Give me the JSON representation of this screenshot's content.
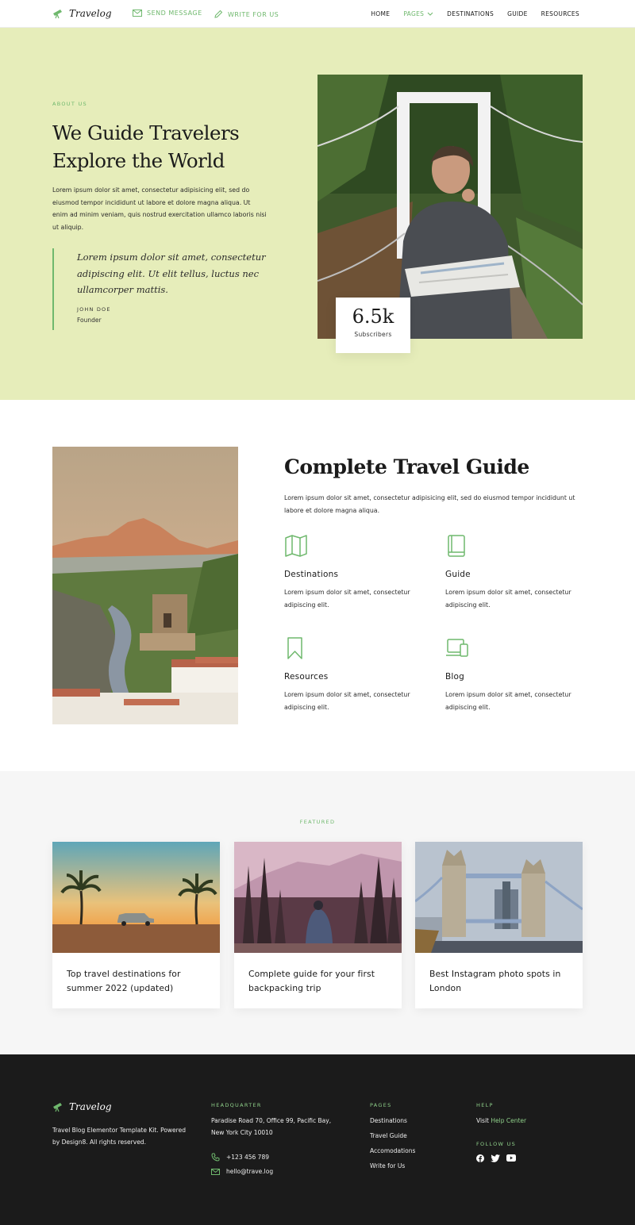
{
  "brand": {
    "name": "Travelog",
    "accent": "#6fb86d",
    "hero_bg": "#e6edba",
    "footer_bg": "#1b1b1b"
  },
  "nav": {
    "send_message": "SEND MESSAGE",
    "write_for_us": "WRITE FOR US",
    "links": [
      "HOME",
      "PAGES",
      "DESTINATIONS",
      "GUIDE",
      "RESOURCES"
    ],
    "active": "PAGES"
  },
  "hero": {
    "eyebrow": "ABOUT US",
    "title": "We Guide Travelers Explore the World",
    "intro": "Lorem ipsum dolor sit amet, consectetur adipisicing elit, sed do eiusmod tempor incididunt ut labore et dolore magna aliqua. Ut enim ad minim veniam, quis nostrud exercitation ullamco laboris nisi ut aliquip.",
    "quote": "Lorem ipsum dolor sit amet, consectetur adipiscing elit. Ut elit tellus, luctus nec ullamcorper mattis.",
    "quote_author": "JOHN DOE",
    "quote_role": "Founder",
    "stat_value": "6.5k",
    "stat_label": "Subscribers"
  },
  "guide": {
    "title": "Complete Travel Guide",
    "desc": "Lorem ipsum dolor sit amet, consectetur adipisicing elit, sed do eiusmod tempor incididunt ut labore et dolore magna aliqua.",
    "features": [
      {
        "title": "Destinations",
        "desc": "Lorem ipsum dolor sit amet, consectetur adipiscing elit.",
        "icon": "map-icon"
      },
      {
        "title": "Guide",
        "desc": "Lorem ipsum dolor sit amet, consectetur adipiscing elit.",
        "icon": "book-icon"
      },
      {
        "title": "Resources",
        "desc": "Lorem ipsum dolor sit amet, consectetur adipiscing elit.",
        "icon": "bookmark-icon"
      },
      {
        "title": "Blog",
        "desc": "Lorem ipsum dolor sit amet, consectetur adipiscing elit.",
        "icon": "devices-icon"
      }
    ]
  },
  "featured": {
    "eyebrow": "FEATURED",
    "posts": [
      {
        "title": "Top travel destinations for summer 2022 (updated)"
      },
      {
        "title": "Complete guide for your first backpacking trip"
      },
      {
        "title": "Best Instagram photo spots in London"
      }
    ]
  },
  "footer": {
    "about": "Travel Blog Elementor Template Kit. Powered by Design8. All rights reserved.",
    "hq_heading": "HEADQUARTER",
    "hq_address": "Paradise Road 70, Office 99, Pacific Bay,  New York City 10010",
    "phone": "+123 456 789",
    "email": "hello@trave.log",
    "pages_heading": "PAGES",
    "pages": [
      "Destinations",
      "Travel Guide",
      "Accomodations",
      "Write for Us"
    ],
    "help_heading": "HELP",
    "help_prefix": "Visit",
    "help_link": "Help Center",
    "follow_heading": "FOLLOW US",
    "socials": [
      "facebook-icon",
      "twitter-icon",
      "youtube-icon"
    ]
  }
}
